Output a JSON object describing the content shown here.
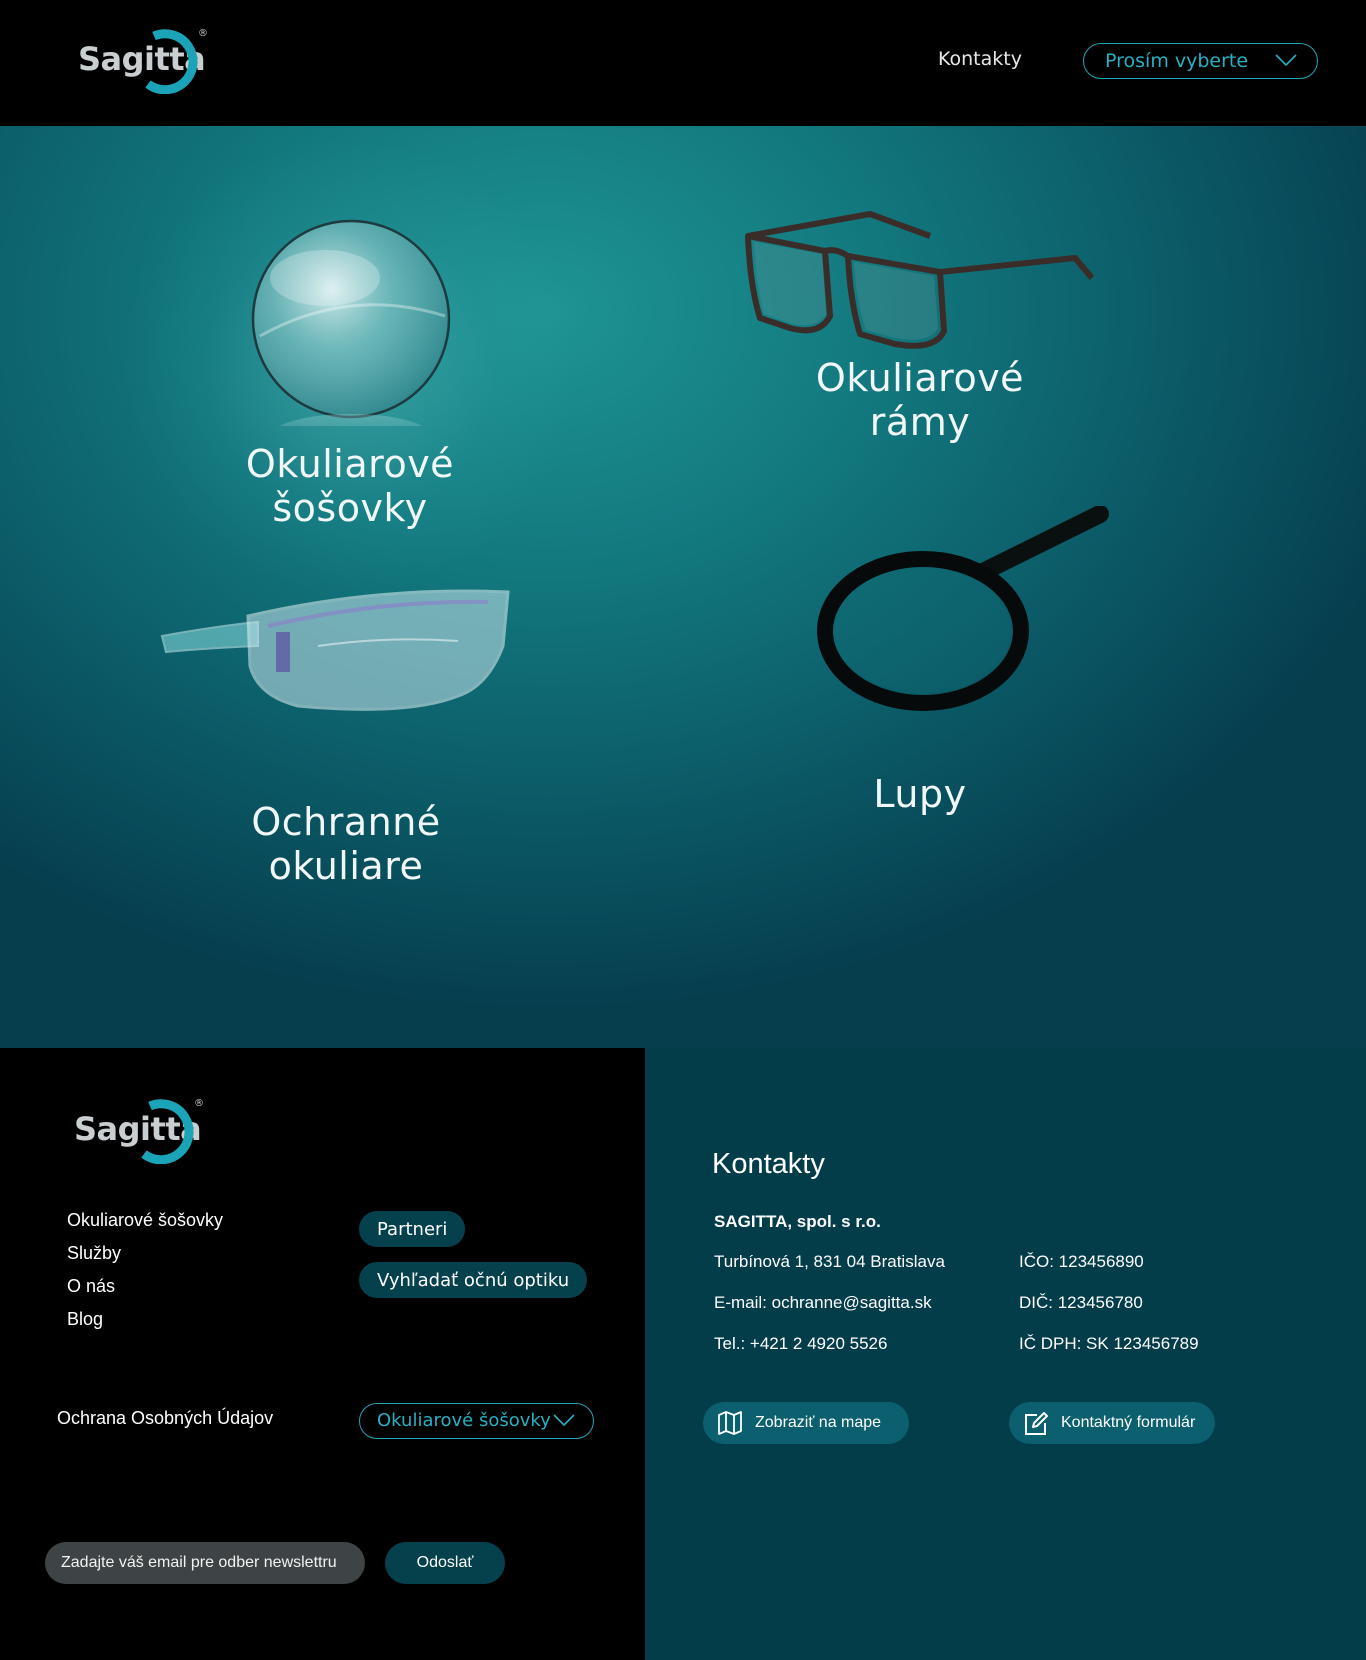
{
  "header": {
    "logo_text": "Sagitta",
    "logo_reg": "®",
    "nav_contacts": "Kontakty",
    "select_label": "Prosím vyberte"
  },
  "hero": {
    "tiles": [
      {
        "line1": "Okuliarové",
        "line2": "šošovky",
        "icon": "lens-image"
      },
      {
        "line1": "Okuliarové",
        "line2": "rámy",
        "icon": "glasses-frame-image"
      },
      {
        "line1": "Ochranné",
        "line2": "okuliare",
        "icon": "safety-glasses-image"
      },
      {
        "line1": "Lupy",
        "line2": "",
        "icon": "magnifier-image"
      }
    ]
  },
  "footer": {
    "logo_text": "Sagitta",
    "logo_reg": "®",
    "nav": [
      "Okuliarové šošovky",
      "Služby",
      "O nás",
      "Blog"
    ],
    "pills": [
      "Partneri",
      "Vyhľadať očnú optiku"
    ],
    "privacy": "Ochrana Osobných Údajov",
    "category_select": "Okuliarové šošovky",
    "newsletter_placeholder": "Zadajte váš email pre odber newslettru",
    "newsletter_button": "Odoslať"
  },
  "contacts": {
    "title": "Kontakty",
    "company": "SAGITTA, spol. s r.o.",
    "address": "Turbínová 1, 831 04  Bratislava",
    "email": "E-mail: ochranne@sagitta.sk",
    "phone": "Tel.: +421 2 4920 5526",
    "ico": "IČO: 123456890",
    "dic": "DIČ: 123456780",
    "icdph": "IČ DPH: SK 123456789",
    "map_button": "Zobraziť na mape",
    "form_button": "Kontaktný formulár"
  },
  "colors": {
    "accent": "#1fa5b7",
    "dark_teal": "#033d4a",
    "pill_bg": "#05414d"
  }
}
